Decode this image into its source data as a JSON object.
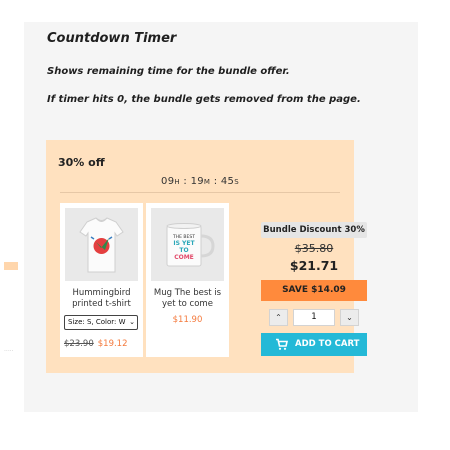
{
  "heading": {
    "title": "Countdown Timer",
    "line1": "Shows remaining time for the bundle offer.",
    "line2": "If timer hits 0, the bundle gets removed from the page."
  },
  "bundle": {
    "badge": "30% off",
    "timer": {
      "hours": "09",
      "hours_unit": "H",
      "minutes": "19",
      "minutes_unit": "M",
      "seconds": "45",
      "seconds_unit": "S"
    },
    "products": [
      {
        "name": "Hummingbird printed t-shirt",
        "option": "Size: S, Color: W",
        "old_price": "$23.90",
        "new_price": "$19.12"
      },
      {
        "name": "Mug The best is yet to come",
        "price": "$11.90",
        "mug_text": [
          "THE BEST",
          "IS YET",
          "TO",
          "COME"
        ]
      }
    ],
    "discount_label": "Bundle Discount 30%",
    "original_total": "$35.80",
    "final_total": "$21.71",
    "save_label": "SAVE $14.09",
    "quantity": "1",
    "add_to_cart": "ADD TO CART",
    "colors": {
      "panel": "#ffe1bf",
      "accent": "#ff8a3c",
      "cart": "#24b9d7",
      "sale": "#f47a3d"
    }
  },
  "footnote": "....."
}
